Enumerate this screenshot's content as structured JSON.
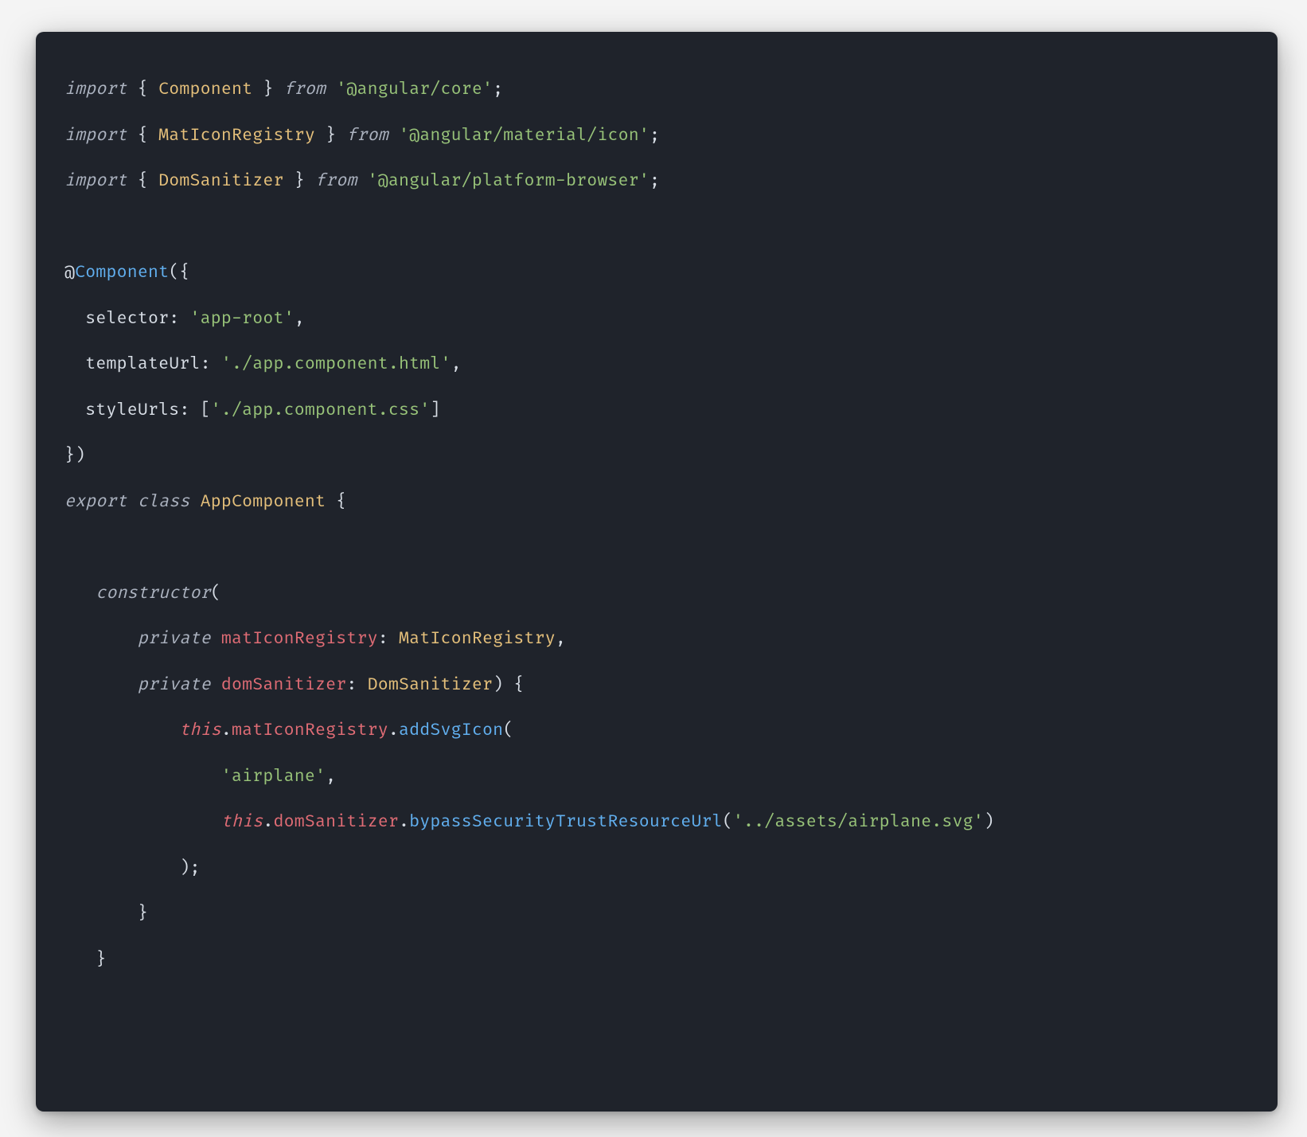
{
  "code": {
    "line1": {
      "kw_import": "import",
      "brace_open": " { ",
      "Component": "Component",
      "brace_close": " } ",
      "kw_from": "from",
      "sp": " ",
      "mod": "'@angular/core'",
      "semi": ";"
    },
    "line2": {
      "kw_import": "import",
      "brace_open": " { ",
      "MatIconRegistry": "MatIconRegistry",
      "brace_close": " } ",
      "kw_from": "from",
      "sp": " ",
      "mod": "'@angular/material/icon'",
      "semi": ";"
    },
    "line3": {
      "kw_import": "import",
      "brace_open": " { ",
      "DomSanitizer": "DomSanitizer",
      "brace_close": " } ",
      "kw_from": "from",
      "sp": " ",
      "mod": "'@angular/platform-browser'",
      "semi": ";"
    },
    "line5": {
      "at": "@",
      "Component": "Component",
      "open": "({"
    },
    "line6": {
      "indent": "  ",
      "selector_key": "selector:",
      "sp": " ",
      "selector_val": "'app-root'",
      "comma": ","
    },
    "line7": {
      "indent": "  ",
      "template_key": "templateUrl:",
      "sp": " ",
      "template_val": "'./app.component.html'",
      "comma": ","
    },
    "line8": {
      "indent": "  ",
      "style_key": "styleUrls:",
      "sp": " [",
      "style_val": "'./app.component.css'",
      "close": "]"
    },
    "line9": {
      "close": "})"
    },
    "line10": {
      "kw_export": "export",
      "sp1": " ",
      "kw_class": "class",
      "sp2": " ",
      "AppComponent": "AppComponent",
      "sp3": " ",
      "brace": "{"
    },
    "line12": {
      "indent": "   ",
      "constructor": "constructor",
      "open": "("
    },
    "line13": {
      "indent": "       ",
      "kw_private": "private",
      "sp": " ",
      "param": "matIconRegistry",
      "colon": ": ",
      "type": "MatIconRegistry",
      "comma": ","
    },
    "line14": {
      "indent": "       ",
      "kw_private": "private",
      "sp": " ",
      "param": "domSanitizer",
      "colon": ": ",
      "type": "DomSanitizer",
      "close": ") {"
    },
    "line15": {
      "indent": "           ",
      "this": "this",
      "dot1": ".",
      "matIconRegistry": "matIconRegistry",
      "dot2": ".",
      "addSvgIcon": "addSvgIcon",
      "open": "("
    },
    "line16": {
      "indent": "               ",
      "str": "'airplane'",
      "comma": ","
    },
    "line17": {
      "indent": "               ",
      "this": "this",
      "dot1": ".",
      "domSanitizer": "domSanitizer",
      "dot2": ".",
      "bypass": "bypassSecurityTrustResourceUrl",
      "open": "(",
      "str": "'../assets/airplane.svg'",
      "close": ")"
    },
    "line18": {
      "indent": "           ",
      "close": ");"
    },
    "line19": {
      "indent": "       ",
      "close": "}"
    },
    "line20": {
      "indent": "   ",
      "close": "}"
    }
  }
}
